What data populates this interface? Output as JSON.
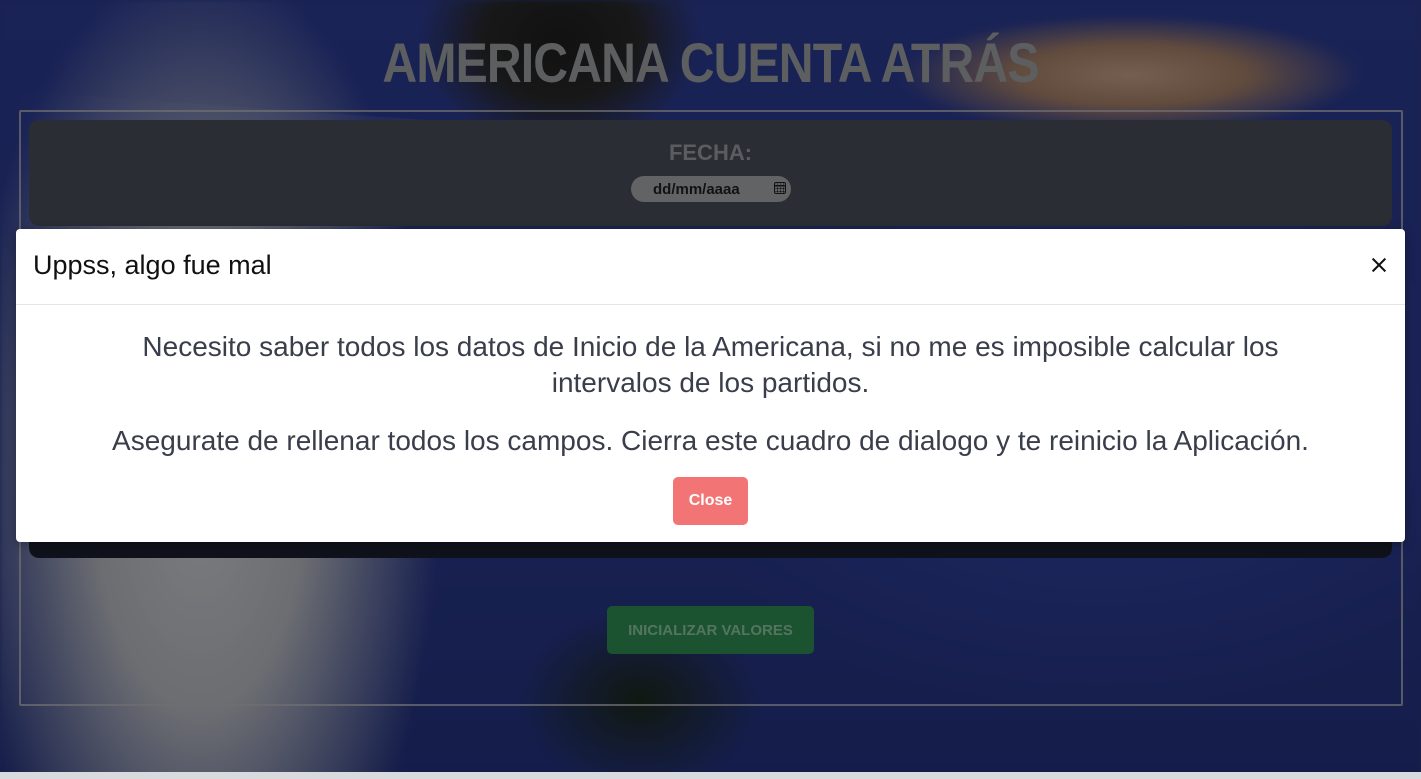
{
  "page": {
    "title": "AMERICANA CUENTA ATRÁS",
    "date_label": "FECHA:",
    "date_placeholder": "dd/mm/aaaa",
    "init_button_label": "INICIALIZAR VALORES"
  },
  "modal": {
    "title": "Uppss, algo fue mal",
    "message_1": "Necesito saber todos los datos de Inicio de la Americana, si no me es imposible calcular los intervalos de los partidos.",
    "message_2": "Asegurate de rellenar todos los campos. Cierra este cuadro de dialogo y te reinicio la Aplicación.",
    "close_button_label": "Close",
    "close_icon": "close-icon"
  },
  "colors": {
    "close_button": "#f37474",
    "init_button": "#2f8f53",
    "date_panel": "#4a4e5c"
  }
}
